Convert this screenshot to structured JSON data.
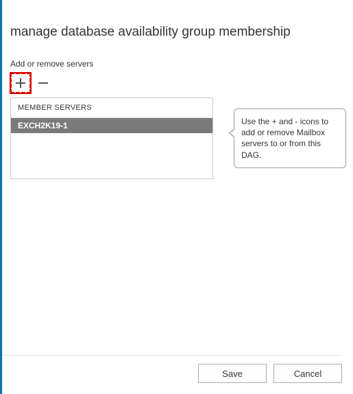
{
  "title": "manage database availability group membership",
  "section_label": "Add or remove servers",
  "toolbar": {
    "add_icon": "plus-icon",
    "remove_icon": "minus-icon"
  },
  "list": {
    "header": "MEMBER SERVERS",
    "rows": [
      "EXCH2K19-1"
    ]
  },
  "tooltip_text": "Use the + and - icons to add or remove Mailbox servers to or from this DAG.",
  "buttons": {
    "save": "Save",
    "cancel": "Cancel"
  }
}
